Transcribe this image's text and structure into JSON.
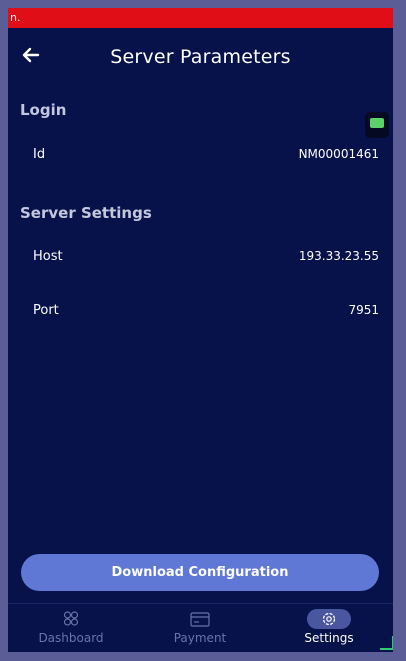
{
  "banner": {
    "text": "n."
  },
  "header": {
    "title": "Server Parameters",
    "back_icon": "arrow-left-icon"
  },
  "login": {
    "section_title": "Login",
    "id_label": "Id",
    "id_value": "NM00001461"
  },
  "server_settings": {
    "section_title": "Server Settings",
    "host_label": "Host",
    "host_value": "193.33.23.55",
    "port_label": "Port",
    "port_value": "7951"
  },
  "actions": {
    "download_label": "Download Configuration"
  },
  "nav": {
    "items": [
      {
        "label": "Dashboard",
        "icon": "grid-icon",
        "active": false
      },
      {
        "label": "Payment",
        "icon": "card-icon",
        "active": false
      },
      {
        "label": "Settings",
        "icon": "gear-icon",
        "active": true
      }
    ]
  },
  "colors": {
    "background": "#07114a",
    "banner": "#e00f17",
    "accent": "#5f78d6",
    "status_green": "#5ad16a"
  }
}
